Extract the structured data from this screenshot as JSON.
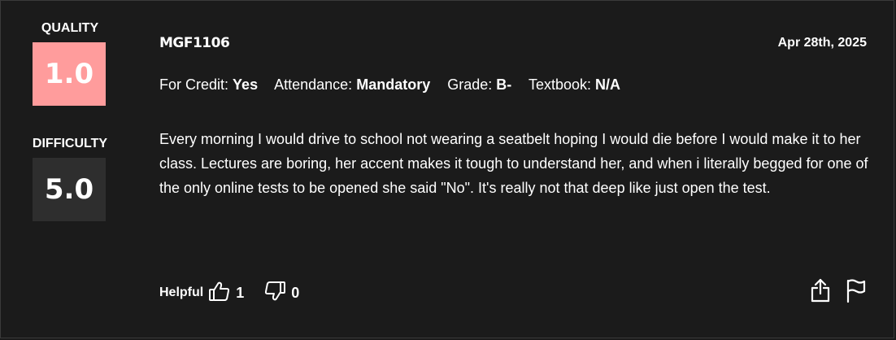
{
  "rating": {
    "quality_label": "QUALITY",
    "quality_value": "1.0",
    "difficulty_label": "DIFFICULTY",
    "difficulty_value": "5.0",
    "quality_color": "#ff9c9c",
    "difficulty_color": "#2e2e2e"
  },
  "review": {
    "course": "MGF1106",
    "date": "Apr 28th, 2025",
    "meta": [
      {
        "label": "For Credit:",
        "value": "Yes"
      },
      {
        "label": "Attendance:",
        "value": "Mandatory"
      },
      {
        "label": "Grade:",
        "value": "B-"
      },
      {
        "label": "Textbook:",
        "value": "N/A"
      }
    ],
    "comment": "Every morning I would drive to school not wearing a seatbelt hoping I would die before I would make it to her class. Lectures are boring, her accent makes it tough to understand her, and when i literally begged for one of the only online tests to be opened she said \"No\". It's really not that deep like just open the test."
  },
  "footer": {
    "helpful_label": "Helpful",
    "thumbs_up_count": "1",
    "thumbs_down_count": "0",
    "icons": [
      "thumbs-up-icon",
      "thumbs-down-icon",
      "share-icon",
      "flag-icon"
    ]
  }
}
